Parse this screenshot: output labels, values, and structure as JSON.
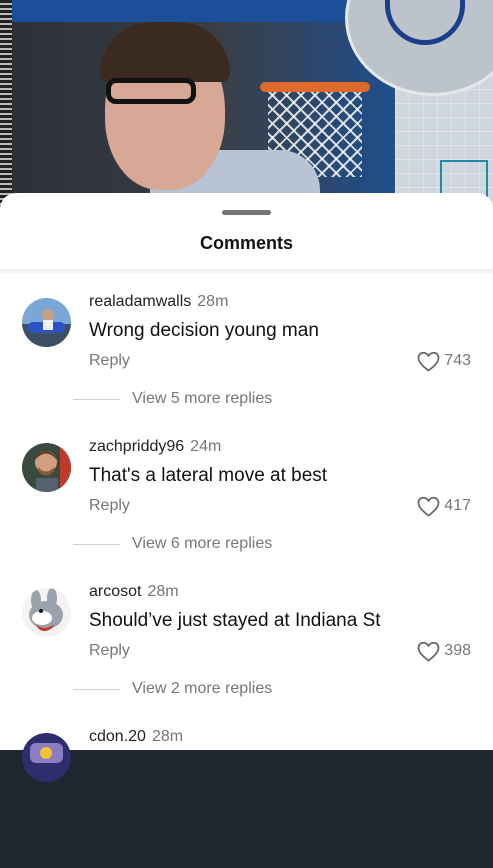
{
  "sheet": {
    "title": "Comments"
  },
  "comments": [
    {
      "username": "realadamwalls",
      "time": "28m",
      "text": "Wrong decision young man",
      "reply_label": "Reply",
      "likes": "743",
      "more_replies": "View 5 more replies"
    },
    {
      "username": "zachpriddy96",
      "time": "24m",
      "text": "That's a lateral move at best",
      "reply_label": "Reply",
      "likes": "417",
      "more_replies": "View 6 more replies"
    },
    {
      "username": "arcosot",
      "time": "28m",
      "text": "Should’ve just stayed at Indiana St",
      "reply_label": "Reply",
      "likes": "398",
      "more_replies": "View 2 more replies"
    },
    {
      "username": "cdon.20",
      "time": "28m"
    }
  ],
  "icons": {
    "like": "heart-outline-icon"
  },
  "colors": {
    "sheet_bg": "#ffffff",
    "secondary_text": "#777777",
    "primary_text": "#111111"
  }
}
